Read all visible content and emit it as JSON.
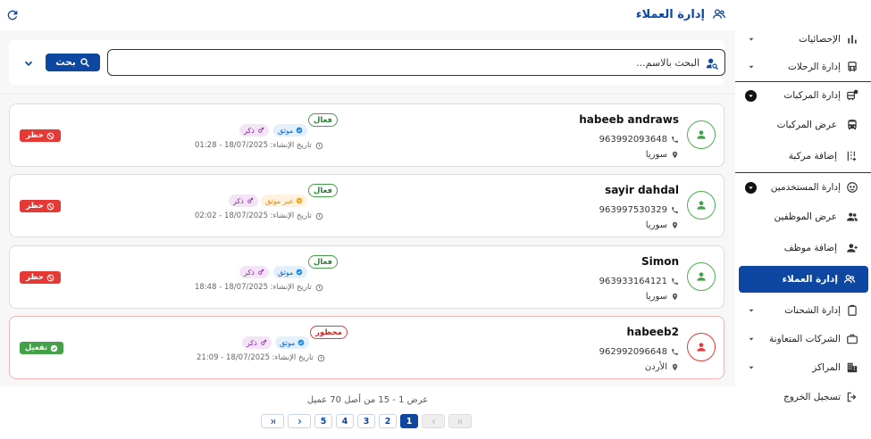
{
  "header": {
    "title": "إدارة العملاء"
  },
  "search": {
    "placeholder": "البحث بالاسم...",
    "button_label": "بحث"
  },
  "customers": [
    {
      "name": "habeeb andraws",
      "phone": "963992093648",
      "country": "سوريا",
      "status": "فعال",
      "status_type": "active",
      "verification": "موثق",
      "verification_type": "verified",
      "gender": "ذكر",
      "created": "تاريخ الإنشاء: 18/07/2025 - 01:28",
      "action": "حظر",
      "action_type": "ban"
    },
    {
      "name": "sayir dahdal",
      "phone": "963997530329",
      "country": "سوريا",
      "status": "فعال",
      "status_type": "active",
      "verification": "غير موثق",
      "verification_type": "unverified",
      "gender": "ذكر",
      "created": "تاريخ الإنشاء: 18/07/2025 - 02:02",
      "action": "حظر",
      "action_type": "ban"
    },
    {
      "name": "Simon",
      "phone": "963933164121",
      "country": "سوريا",
      "status": "فعال",
      "status_type": "active",
      "verification": "موثق",
      "verification_type": "verified",
      "gender": "ذكر",
      "created": "تاريخ الإنشاء: 18/07/2025 - 18:48",
      "action": "حظر",
      "action_type": "ban"
    },
    {
      "name": "habeeb2",
      "phone": "962992096648",
      "country": "الأردن",
      "status": "محظور",
      "status_type": "blocked",
      "verification": "موثق",
      "verification_type": "verified",
      "gender": "ذكر",
      "created": "تاريخ الإنشاء: 18/07/2025 - 21:09",
      "action": "تفعيل",
      "action_type": "activate"
    }
  ],
  "pagination": {
    "info": "عرض 1 - 15 من أصل 70 عميل",
    "pages": [
      "1",
      "2",
      "3",
      "4",
      "5"
    ],
    "current": "1"
  },
  "sidebar": {
    "items": [
      {
        "label": "الإحصائيات",
        "icon": "bar-chart-icon"
      },
      {
        "label": "إدارة الرحلات",
        "icon": "bus-icon"
      },
      {
        "label": "إدارة المركبات",
        "icon": "vehicle-alert-icon"
      },
      {
        "label": "عرض المركبات",
        "icon": "bus-front-icon"
      },
      {
        "label": "إضافة مركبة",
        "icon": "add-vehicle-icon"
      },
      {
        "label": "إدارة المستخدمين",
        "icon": "face-icon"
      },
      {
        "label": "عرض الموظفين",
        "icon": "group-icon"
      },
      {
        "label": "إضافة موظف",
        "icon": "person-add-icon"
      },
      {
        "label": "إدارة العملاء",
        "icon": "customers-icon"
      },
      {
        "label": "إدارة الشحنات",
        "icon": "clipboard-icon"
      },
      {
        "label": "الشركات المتعاونة",
        "icon": "briefcase-icon"
      },
      {
        "label": "المراكز",
        "icon": "building-icon"
      },
      {
        "label": "تسجيل الخروج",
        "icon": "logout-icon"
      }
    ]
  },
  "colors": {
    "primary": "#0d47a1",
    "active_green": "#43a047",
    "ban_red": "#e53935",
    "verified_blue": "#1565c0",
    "unverified_orange": "#e68a00",
    "gender_purple": "#8e24aa"
  }
}
